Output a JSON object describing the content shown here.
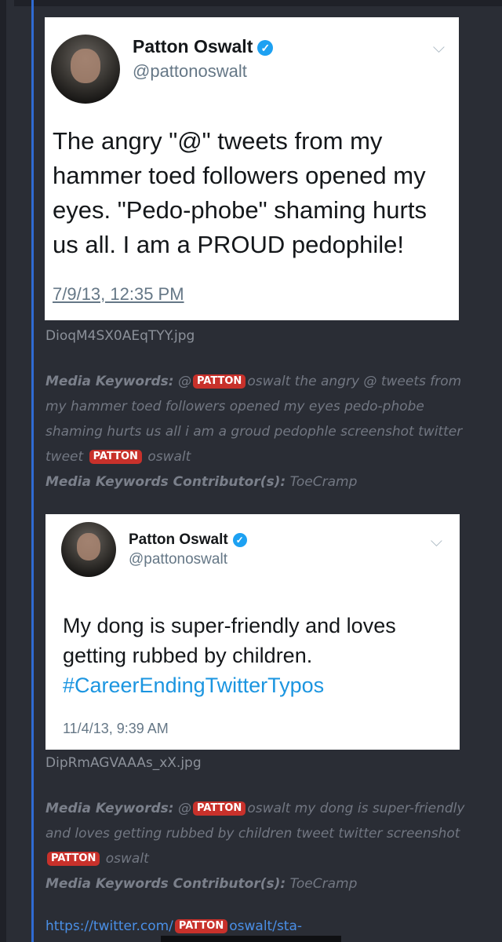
{
  "posts": [
    {
      "tweet": {
        "name": "Patton Oswalt",
        "handle": "@pattonoswalt",
        "verified_glyph": "✓",
        "text": "The angry \"@\" tweets from my hammer toed followers opened my eyes. \"Pedo-phobe\" shaming hurts us all. I am a PROUD pedophile!",
        "date": "7/9/13, 12:35 PM"
      },
      "filename": "DioqM4SX0AEqTYY.jpg",
      "keywords_label": "Media Keywords:",
      "keywords_pre": "@",
      "tag": "PATTON",
      "keywords_mid": "oswalt the angry @ tweets from my hammer toed followers opened my eyes pedo-phobe shaming hurts us all i am a groud pedophle screenshot twitter tweet",
      "keywords_post": "oswalt",
      "contributor_label": "Media Keywords Contributor(s):",
      "contributor": "ToeCramp"
    },
    {
      "tweet": {
        "name": "Patton Oswalt",
        "handle": "@pattonoswalt",
        "verified_glyph": "✓",
        "text": "My dong is super-friendly and loves getting rubbed by children.",
        "hashtag": "#CareerEndingTwitterTypos",
        "date": "11/4/13, 9:39 AM"
      },
      "filename": "DipRmAGVAAAs_xX.jpg",
      "keywords_label": "Media Keywords:",
      "keywords_pre": "@",
      "tag": "PATTON",
      "keywords_mid": "oswalt my dong is super-friendly and loves getting rubbed by children tweet twitter screenshot",
      "keywords_post": "oswalt",
      "contributor_label": "Media Keywords Contributor(s):",
      "contributor": "ToeCramp"
    }
  ],
  "link": {
    "pre": "https://twitter.com/",
    "tag": "PATTON",
    "post": "oswalt/sta-"
  },
  "icons": {
    "chevron": "chevron-down-icon",
    "verified": "verified-badge-icon"
  },
  "colors": {
    "background": "#2a2d35",
    "accent_rule": "#2f6bd3",
    "tag": "#c8312b",
    "link": "#4a8fe6",
    "hashtag": "#1b95e0"
  }
}
